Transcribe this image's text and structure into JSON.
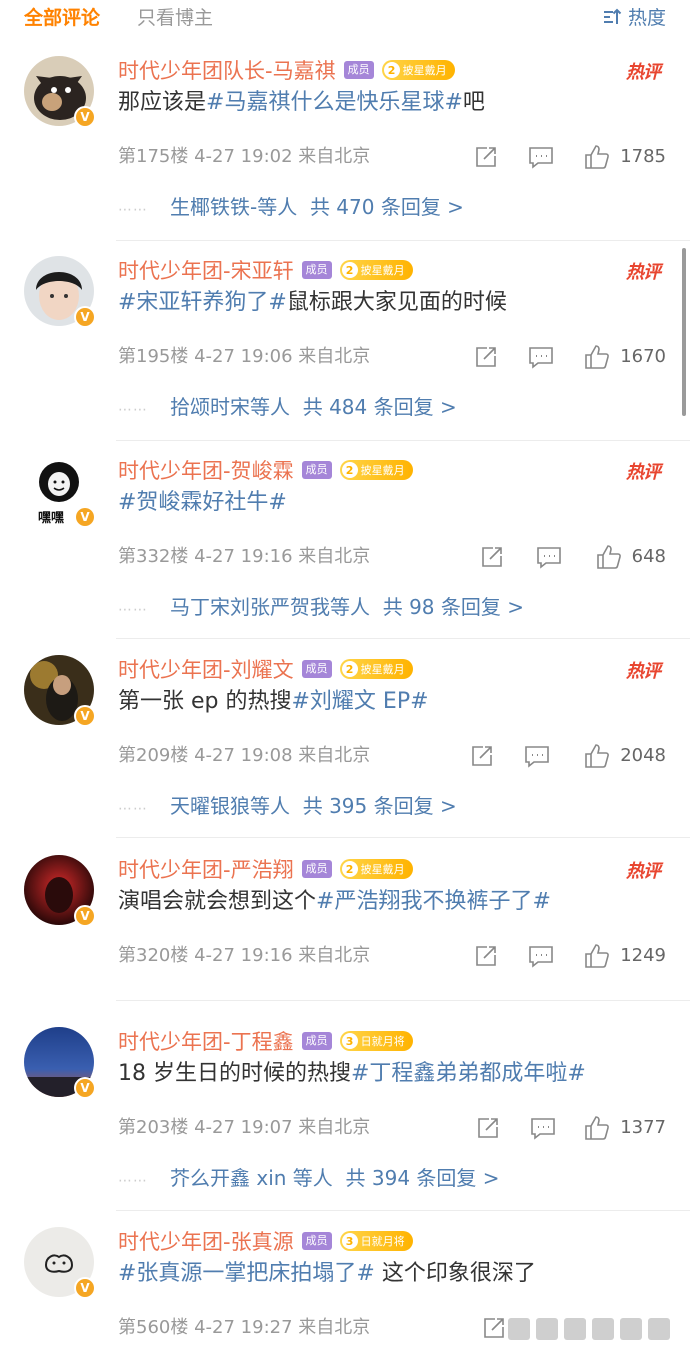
{
  "header": {
    "tab_all": "全部评论",
    "tab_author": "只看博主",
    "sort_label": "热度"
  },
  "colors": {
    "accent": "#ff8200",
    "name": "#eb7350",
    "link": "#507daf",
    "hot": "#e8452f",
    "meta": "#999999"
  },
  "member_label": "成员",
  "hot_label": "热评",
  "comments": [
    {
      "name": "时代少年团队长-马嘉祺",
      "badge_level": "2",
      "badge_text": "披星戴月",
      "pre": "那应该是",
      "tag": "#马嘉祺什么是快乐星球#",
      "post": "吧",
      "floor": "第175楼",
      "time": "4-27 19:02",
      "source": "来自北京",
      "likes": "1785",
      "reply_users": "生椰铁铁-等人",
      "reply_count": "共 470 条回复 >"
    },
    {
      "name": "时代少年团-宋亚轩",
      "badge_level": "2",
      "badge_text": "披星戴月",
      "pre": "",
      "tag": "#宋亚轩养狗了#",
      "post": "鼠标跟大家见面的时候",
      "floor": "第195楼",
      "time": "4-27 19:06",
      "source": "来自北京",
      "likes": "1670",
      "reply_users": "拾颂时宋等人",
      "reply_count": "共 484 条回复 >"
    },
    {
      "name": "时代少年团-贺峻霖",
      "badge_level": "2",
      "badge_text": "披星戴月",
      "pre": "",
      "tag": "#贺峻霖好社牛#",
      "post": "",
      "floor": "第332楼",
      "time": "4-27 19:16",
      "source": "来自北京",
      "likes": "648",
      "reply_users": "马丁宋刘张严贺我等人",
      "reply_count": "共 98 条回复 >"
    },
    {
      "name": "时代少年团-刘耀文",
      "badge_level": "2",
      "badge_text": "披星戴月",
      "pre": "第一张 ep 的热搜",
      "tag": "#刘耀文 EP#",
      "post": "",
      "floor": "第209楼",
      "time": "4-27 19:08",
      "source": "来自北京",
      "likes": "2048",
      "reply_users": "天曜银狼等人",
      "reply_count": "共 395 条回复 >"
    },
    {
      "name": "时代少年团-严浩翔",
      "badge_level": "2",
      "badge_text": "披星戴月",
      "pre": "演唱会就会想到这个",
      "tag": "#严浩翔我不换裤子了#",
      "post": "",
      "floor": "第320楼",
      "time": "4-27 19:16",
      "source": "来自北京",
      "likes": "1249",
      "reply_users": "",
      "reply_count": ""
    },
    {
      "name": "时代少年团-丁程鑫",
      "badge_level": "3",
      "badge_text": "日就月将",
      "pre": "18 岁生日的时候的热搜",
      "tag": "#丁程鑫弟弟都成年啦#",
      "post": "",
      "floor": "第203楼",
      "time": "4-27 19:07",
      "source": "来自北京",
      "likes": "1377",
      "reply_users": "芥么开鑫 xin 等人",
      "reply_count": "共 394 条回复 >"
    },
    {
      "name": "时代少年团-张真源",
      "badge_level": "3",
      "badge_text": "日就月将",
      "pre": "",
      "tag": "#张真源一掌把床拍塌了#",
      "post": " 这个印象很深了",
      "floor": "第560楼",
      "time": "4-27 19:27",
      "source": "来自北京",
      "likes": "",
      "reply_users": "",
      "reply_count": ""
    }
  ],
  "avatar_caption_3": "嘿嘿"
}
